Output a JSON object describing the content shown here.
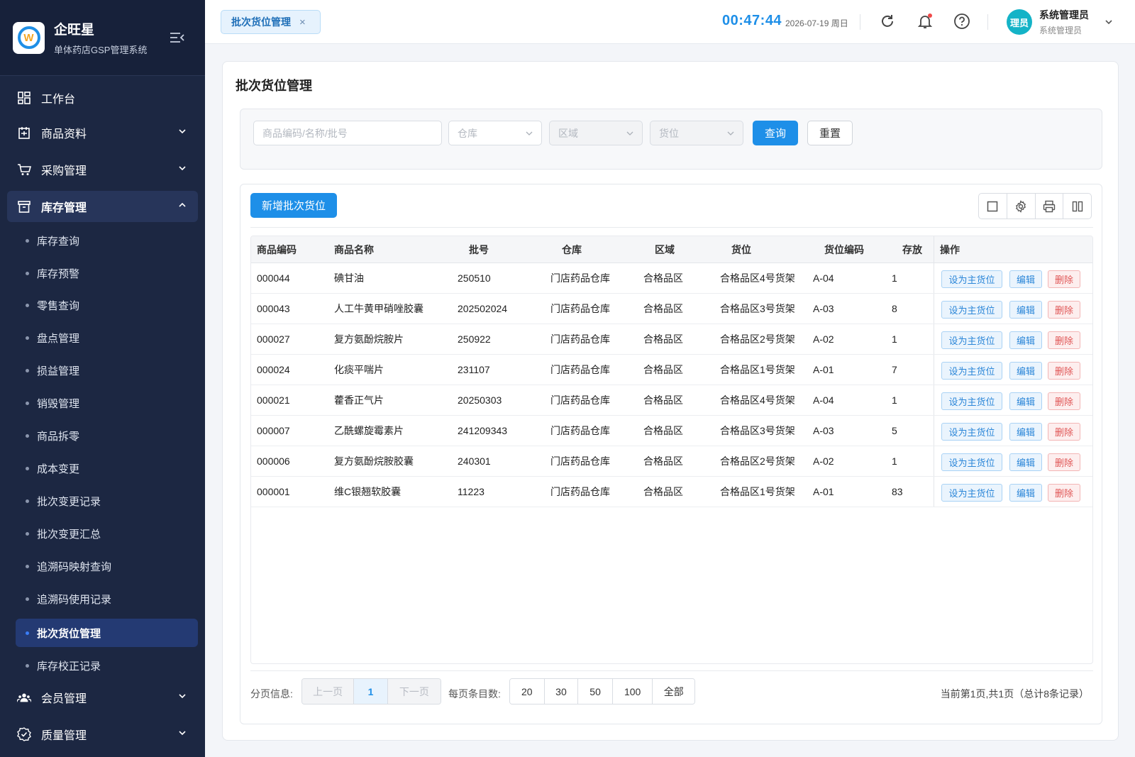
{
  "app": {
    "name": "企旺星",
    "subtitle": "单体药店GSP管理系统"
  },
  "sidebar": {
    "menu": [
      {
        "label": "工作台",
        "icon": "dashboard-icon"
      },
      {
        "label": "商品资料",
        "icon": "product-icon"
      },
      {
        "label": "采购管理",
        "icon": "cart-icon"
      },
      {
        "label": "库存管理",
        "icon": "inventory-icon"
      },
      {
        "label": "会员管理",
        "icon": "members-icon"
      },
      {
        "label": "质量管理",
        "icon": "quality-icon"
      }
    ],
    "inventory_sub": [
      "库存查询",
      "库存预警",
      "零售查询",
      "盘点管理",
      "损益管理",
      "销毁管理",
      "商品拆零",
      "成本变更",
      "批次变更记录",
      "批次变更汇总",
      "追溯码映射查询",
      "追溯码使用记录",
      "批次货位管理",
      "库存校正记录"
    ]
  },
  "topbar": {
    "tab_label": "批次货位管理",
    "tab_close": "×",
    "clock": "00:47:44",
    "date": "2026-07-19 周日",
    "avatar_text": "理员",
    "user_name": "系统管理员",
    "user_role": "系统管理员"
  },
  "page": {
    "title": "批次货位管理"
  },
  "filter": {
    "keyword_placeholder": "商品编码/名称/批号",
    "warehouse_placeholder": "仓库",
    "area_placeholder": "区域",
    "location_placeholder": "货位",
    "query_label": "查询",
    "reset_label": "重置"
  },
  "toolbar": {
    "add_label": "新增批次货位"
  },
  "table": {
    "headers": {
      "code": "商品编码",
      "name": "商品名称",
      "batch": "批号",
      "warehouse": "仓库",
      "area": "区域",
      "location": "货位",
      "loc_code": "货位编码",
      "qty": "存放",
      "ops": "操作"
    },
    "op_labels": {
      "set_main": "设为主货位",
      "edit": "编辑",
      "delete": "删除"
    },
    "rows": [
      {
        "code": "000044",
        "name": "碘甘油",
        "batch": "250510",
        "warehouse": "门店药品仓库",
        "area": "合格品区",
        "location": "合格品区4号货架",
        "loc_code": "A-04",
        "qty": "1"
      },
      {
        "code": "000043",
        "name": "人工牛黄甲硝唑胶囊",
        "batch": "202502024",
        "warehouse": "门店药品仓库",
        "area": "合格品区",
        "location": "合格品区3号货架",
        "loc_code": "A-03",
        "qty": "8"
      },
      {
        "code": "000027",
        "name": "复方氨酚烷胺片",
        "batch": "250922",
        "warehouse": "门店药品仓库",
        "area": "合格品区",
        "location": "合格品区2号货架",
        "loc_code": "A-02",
        "qty": "1"
      },
      {
        "code": "000024",
        "name": "化痰平喘片",
        "batch": "231107",
        "warehouse": "门店药品仓库",
        "area": "合格品区",
        "location": "合格品区1号货架",
        "loc_code": "A-01",
        "qty": "7"
      },
      {
        "code": "000021",
        "name": "藿香正气片",
        "batch": "20250303",
        "warehouse": "门店药品仓库",
        "area": "合格品区",
        "location": "合格品区4号货架",
        "loc_code": "A-04",
        "qty": "1"
      },
      {
        "code": "000007",
        "name": "乙酰螺旋霉素片",
        "batch": "241209343",
        "warehouse": "门店药品仓库",
        "area": "合格品区",
        "location": "合格品区3号货架",
        "loc_code": "A-03",
        "qty": "5"
      },
      {
        "code": "000006",
        "name": "复方氨酚烷胺胶囊",
        "batch": "240301",
        "warehouse": "门店药品仓库",
        "area": "合格品区",
        "location": "合格品区2号货架",
        "loc_code": "A-02",
        "qty": "1"
      },
      {
        "code": "000001",
        "name": "维C银翘软胶囊",
        "batch": "11223",
        "warehouse": "门店药品仓库",
        "area": "合格品区",
        "location": "合格品区1号货架",
        "loc_code": "A-01",
        "qty": "83"
      }
    ]
  },
  "pager": {
    "info_label": "分页信息:",
    "prev": "上一页",
    "current": "1",
    "next": "下一页",
    "size_label": "每页条目数:",
    "sizes": [
      "20",
      "30",
      "50",
      "100",
      "全部"
    ],
    "summary": "当前第1页,共1页（总计8条记录）"
  },
  "colors": {
    "sidebar": "#1c2742",
    "accent": "#1e8fe8",
    "danger": "#e05555"
  }
}
